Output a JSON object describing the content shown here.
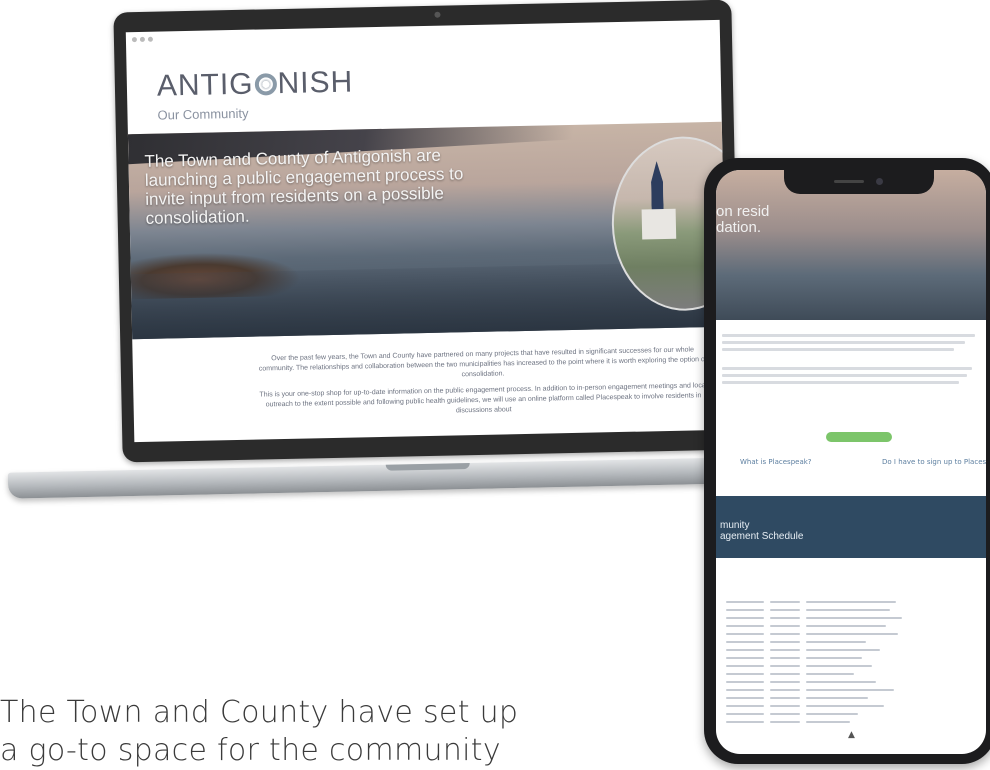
{
  "laptop": {
    "site": {
      "brand": "ANTIGONISH",
      "brand_sub": "Our Community",
      "hero_headline": "The Town and County of Antigonish are launching a public engagement process to invite input from residents on a possible consolidation.",
      "intro_paragraphs": [
        "Over the past few years, the Town and County have partnered on many projects that have resulted in significant successes for our whole community. The relationships and collaboration between the two municipalities has increased to the point where it is worth exploring the option of consolidation.",
        "This is your one-stop shop for up-to-date information on the public engagement process. In addition to in-person engagement meetings and local outreach to the extent possible and following public health guidelines, we will use an online platform called Placespeak to involve residents in discussions about"
      ]
    }
  },
  "phone": {
    "hero_text": "on resid\ndation.",
    "col_left_title": "What is Placespeak?",
    "col_right_title": "Do I have to sign up to Placespeak?",
    "band_text": "munity\nagement Schedule"
  },
  "caption": "The Town and County have set up\na go-to space for the community"
}
